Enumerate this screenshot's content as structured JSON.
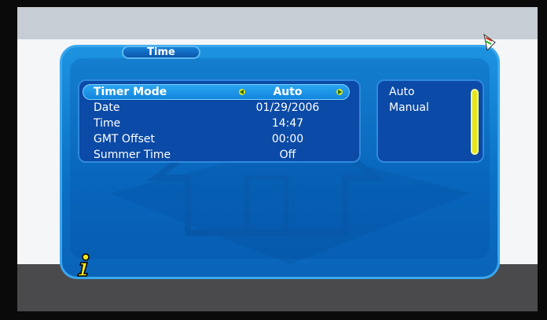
{
  "screen": {
    "title": "Time"
  },
  "menu": {
    "items": [
      {
        "label": "Timer Mode",
        "value": "Auto"
      },
      {
        "label": "Date",
        "value": "01/29/2006"
      },
      {
        "label": "Time",
        "value": "14:47"
      },
      {
        "label": "GMT Offset",
        "value": "00:00"
      },
      {
        "label": "Summer Time",
        "value": "Off"
      }
    ]
  },
  "options": {
    "items": [
      "Auto",
      "Manual"
    ]
  },
  "icons": {
    "info": "info-icon",
    "corner": "dish-icon",
    "arrow_left": "arrow-left-icon",
    "arrow_right": "arrow-right-icon"
  },
  "colors": {
    "panel": "#0a6fc4",
    "selected_row": "#1285dd",
    "accent_yellow": "#e6e619"
  }
}
